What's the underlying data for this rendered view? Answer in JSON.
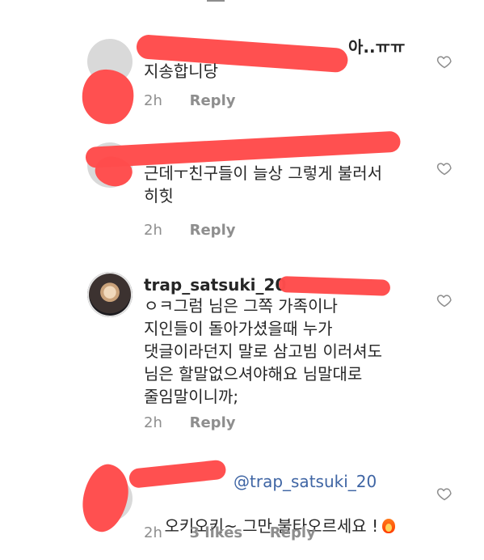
{
  "colors": {
    "text_primary": "#262626",
    "text_secondary": "#8e8e8e",
    "mention": "#3f65a4",
    "redaction": "#ff4d4d"
  },
  "top_fragment": "",
  "comments": [
    {
      "username_visible_suffix": "아..ㅠㅠ",
      "text": "지송합니당",
      "time": "2h",
      "reply": "Reply"
    },
    {
      "username_visible_suffix": "",
      "text": "근데ㅜ친구들이 늘상 그렇게 불러서\n히힛",
      "time": "2h",
      "reply": "Reply"
    },
    {
      "username": "trap_satsuki_20",
      "text": "ㅇㅋ그럼 님은 그쪽 가족이나\n지인들이 돌아가셨을때 누가\n댓글이라던지 말로 삼고빔 이러셔도\n님은 할말없으셔야해요 님말대로\n줄임말이니까;",
      "time": "2h",
      "reply": "Reply"
    },
    {
      "mention": "@trap_satsuki_20",
      "text": "오키오키~ 그만 불타오르세요 !",
      "time": "2h",
      "likes": "3 likes",
      "reply": "Reply"
    }
  ]
}
